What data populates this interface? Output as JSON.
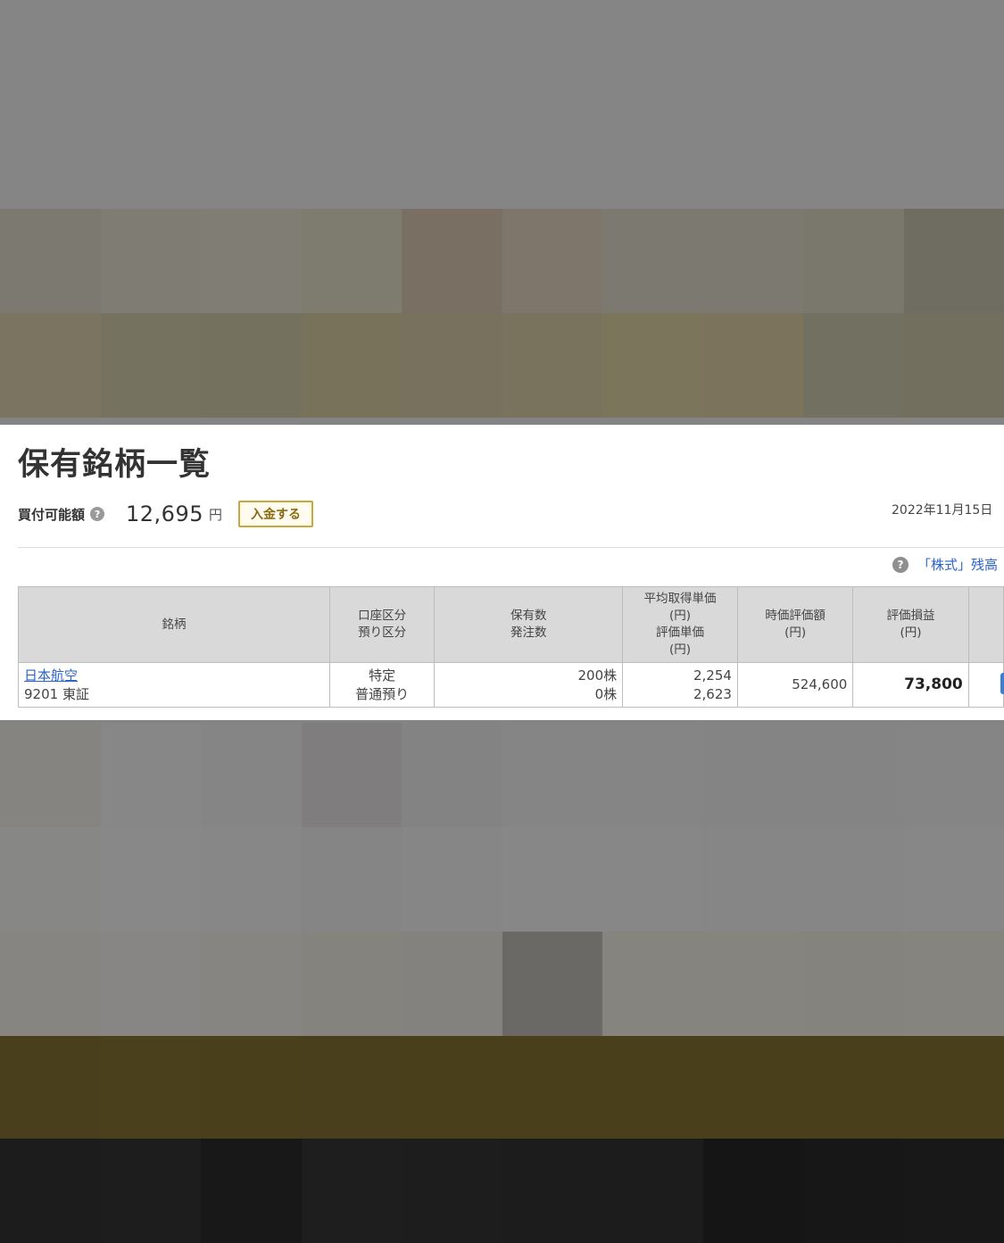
{
  "page": {
    "title": "保有銘柄一覧",
    "buying_power": {
      "label": "買付可能額",
      "help_icon": "question-circle-icon",
      "amount": "12,695",
      "unit": "円",
      "deposit_button": "入金する"
    },
    "date": "2022年11月15日",
    "zandaka_link": "「株式」残高"
  },
  "holdings_table": {
    "headers": {
      "stock": "銘柄",
      "account_type": [
        "口座区分",
        "預り区分"
      ],
      "quantity": [
        "保有数",
        "発注数"
      ],
      "price": [
        "平均取得単価",
        "(円)",
        "評価単価",
        "(円)"
      ],
      "market_value": [
        "時価評価額",
        "(円)"
      ],
      "profit_loss": [
        "評価損益",
        "(円)"
      ]
    },
    "rows": [
      {
        "name": "日本航空",
        "code_market": "9201 東証",
        "account": "特定",
        "deposit_type": "普通預り",
        "held": "200株",
        "ordered": "0株",
        "avg_cost": "2,254",
        "eval_price": "2,623",
        "market_value": "524,600",
        "profit_loss": "73,800"
      }
    ]
  },
  "colors": {
    "link": "#2a63c9",
    "header_bg": "#d9d9d9",
    "deposit_border": "#c9a83a"
  }
}
